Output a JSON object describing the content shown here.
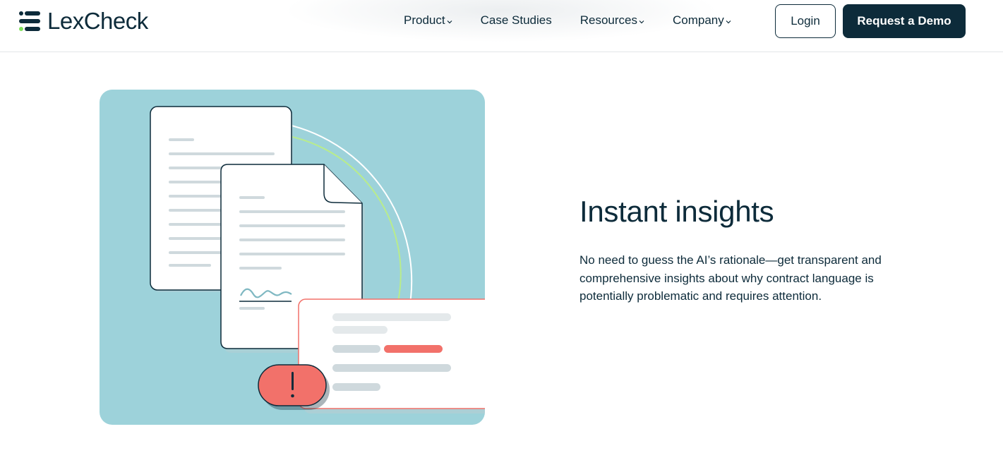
{
  "brand": {
    "name": "LexCheck",
    "colors": {
      "navy": "#0d2b3a",
      "green": "#7fe05a",
      "teal_bg": "#9dd2da",
      "alert_red": "#f2716a"
    }
  },
  "nav": {
    "items": [
      {
        "label": "Product",
        "has_dropdown": true
      },
      {
        "label": "Case Studies",
        "has_dropdown": false
      },
      {
        "label": "Resources",
        "has_dropdown": true
      },
      {
        "label": "Company",
        "has_dropdown": true
      }
    ],
    "login_label": "Login",
    "demo_label": "Request a Demo"
  },
  "feature": {
    "heading": "Instant insights",
    "body": "No need to guess the AI’s rationale—get transparent and comprehensive insights about why contract language is potentially problematic and requires attention.",
    "illustration_icons": [
      "document-icon",
      "signed-document-icon",
      "review-panel-icon",
      "alert-icon"
    ]
  }
}
